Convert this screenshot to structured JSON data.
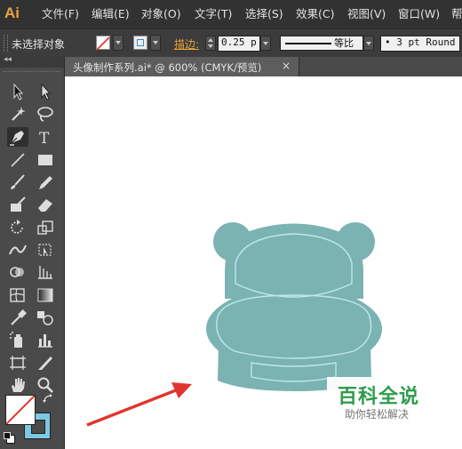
{
  "app": {
    "logo": "Ai"
  },
  "menu": [
    "文件(F)",
    "编辑(E)",
    "对象(O)",
    "文字(T)",
    "选择(S)",
    "效果(C)",
    "视图(V)",
    "窗口(W)",
    "帮"
  ],
  "control": {
    "selection_label": "未选择对象",
    "stroke_label": "描边:",
    "stroke_weight": "0.25 p",
    "profile_label": "等比",
    "brush_value": "3 pt Round"
  },
  "document": {
    "tab_title": "头像制作系列.ai* @ 600% (CMYK/预览)",
    "close_symbol": "×"
  },
  "toolbox": {
    "collapse_symbol": "◂◂",
    "tools": [
      "selection-tool-icon",
      "direct-selection-tool-icon",
      "magic-wand-tool-icon",
      "lasso-tool-icon",
      "pen-tool-icon",
      "type-tool-icon",
      "line-segment-tool-icon",
      "rectangle-tool-icon",
      "paintbrush-tool-icon",
      "pencil-tool-icon",
      "blob-brush-tool-icon",
      "eraser-tool-icon",
      "rotate-tool-icon",
      "scale-tool-icon",
      "width-tool-icon",
      "free-transform-tool-icon",
      "shape-builder-tool-icon",
      "perspective-grid-tool-icon",
      "mesh-tool-icon",
      "gradient-tool-icon",
      "eyedropper-tool-icon",
      "blend-tool-icon",
      "symbol-sprayer-tool-icon",
      "column-graph-tool-icon",
      "artboard-tool-icon",
      "slice-tool-icon",
      "hand-tool-icon",
      "zoom-tool-icon"
    ],
    "selected_tool": "pen-tool-icon"
  },
  "watermark": {
    "title": "百科全说",
    "subtitle": "助你轻松解决"
  },
  "colors": {
    "hippo_fill": "#7ab3b2",
    "hippo_stroke": "#bfe6f0",
    "arrow": "#e0352e",
    "logo": "#e8a33a",
    "stroke_label": "#e8a33a",
    "fill_swatch_stroke": "#7ec8e3",
    "watermark_title": "#2f9c4c"
  }
}
